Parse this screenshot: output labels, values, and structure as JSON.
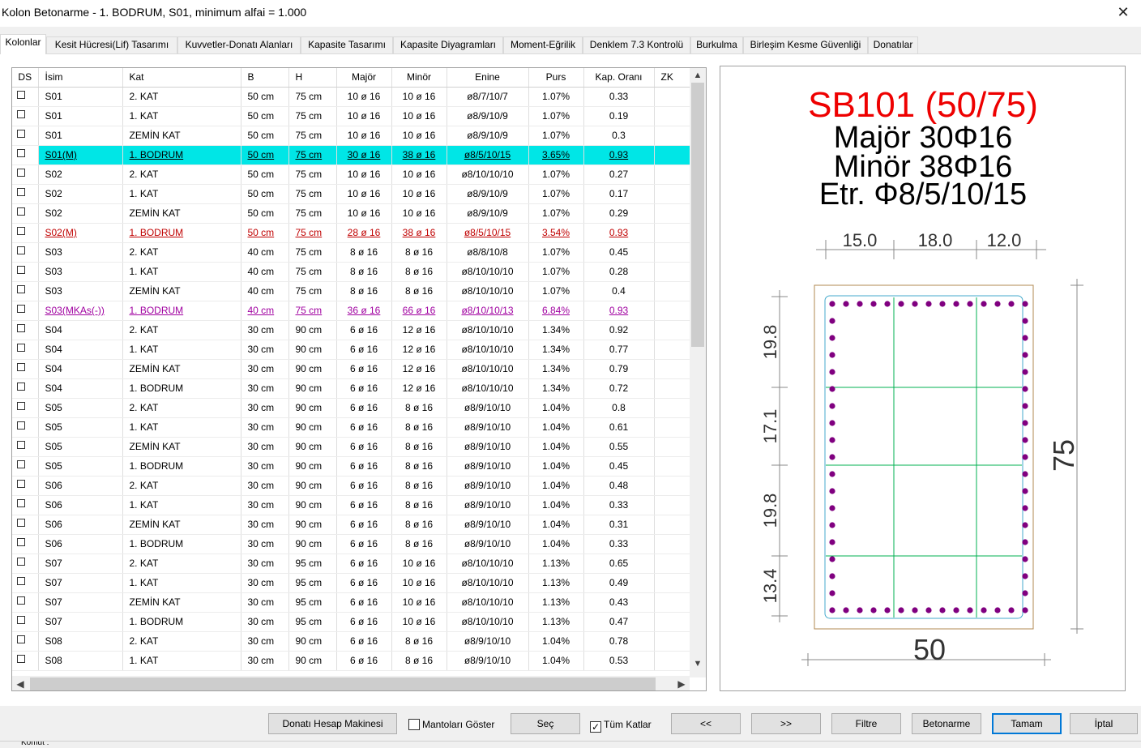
{
  "window": {
    "title": "Kolon Betonarme - 1. BODRUM, S01, minimum alfai = 1.000",
    "close_glyph": "✕"
  },
  "tabs": [
    {
      "label": "Kolonlar",
      "active": true
    },
    {
      "label": "Kesit Hücresi(Lif) Tasarımı"
    },
    {
      "label": "Kuvvetler-Donatı Alanları"
    },
    {
      "label": "Kapasite Tasarımı"
    },
    {
      "label": "Kapasite Diyagramları"
    },
    {
      "label": "Moment-Eğrilik"
    },
    {
      "label": "Denklem 7.3 Kontrolü"
    },
    {
      "label": "Burkulma"
    },
    {
      "label": "Birleşim Kesme Güvenliği"
    },
    {
      "label": "Donatılar"
    }
  ],
  "table": {
    "headers": [
      "DS",
      "İsim",
      "Kat",
      "B",
      "H",
      "Majör",
      "Minör",
      "Enine",
      "Purs",
      "Kap. Oranı",
      "ZK"
    ],
    "rows": [
      {
        "isim": "S01",
        "kat": "2. KAT",
        "b": "50 cm",
        "h": "75 cm",
        "major": "10 ø 16",
        "minor": "10 ø 16",
        "enine": "ø8/7/10/7",
        "purs": "1.07%",
        "kap": "0.33",
        "style": ""
      },
      {
        "isim": "S01",
        "kat": "1. KAT",
        "b": "50 cm",
        "h": "75 cm",
        "major": "10 ø 16",
        "minor": "10 ø 16",
        "enine": "ø8/9/10/9",
        "purs": "1.07%",
        "kap": "0.19",
        "style": ""
      },
      {
        "isim": "S01",
        "kat": "ZEMİN KAT",
        "b": "50 cm",
        "h": "75 cm",
        "major": "10 ø 16",
        "minor": "10 ø 16",
        "enine": "ø8/9/10/9",
        "purs": "1.07%",
        "kap": "0.3",
        "style": ""
      },
      {
        "isim": "S01(M)",
        "kat": "1. BODRUM",
        "b": "50 cm",
        "h": "75 cm",
        "major": "30 ø 16",
        "minor": "38 ø 16",
        "enine": "ø8/5/10/15",
        "purs": "3.65%",
        "kap": "0.93",
        "style": "selected"
      },
      {
        "isim": "S02",
        "kat": "2. KAT",
        "b": "50 cm",
        "h": "75 cm",
        "major": "10 ø 16",
        "minor": "10 ø 16",
        "enine": "ø8/10/10/10",
        "purs": "1.07%",
        "kap": "0.27",
        "style": ""
      },
      {
        "isim": "S02",
        "kat": "1. KAT",
        "b": "50 cm",
        "h": "75 cm",
        "major": "10 ø 16",
        "minor": "10 ø 16",
        "enine": "ø8/9/10/9",
        "purs": "1.07%",
        "kap": "0.17",
        "style": ""
      },
      {
        "isim": "S02",
        "kat": "ZEMİN KAT",
        "b": "50 cm",
        "h": "75 cm",
        "major": "10 ø 16",
        "minor": "10 ø 16",
        "enine": "ø8/9/10/9",
        "purs": "1.07%",
        "kap": "0.29",
        "style": ""
      },
      {
        "isim": "S02(M)",
        "kat": "1. BODRUM",
        "b": "50 cm",
        "h": "75 cm",
        "major": "28 ø 16",
        "minor": "38 ø 16",
        "enine": "ø8/5/10/15",
        "purs": "3.54%",
        "kap": "0.93",
        "style": "red"
      },
      {
        "isim": "S03",
        "kat": "2. KAT",
        "b": "40 cm",
        "h": "75 cm",
        "major": "8 ø 16",
        "minor": "8 ø 16",
        "enine": "ø8/8/10/8",
        "purs": "1.07%",
        "kap": "0.45",
        "style": ""
      },
      {
        "isim": "S03",
        "kat": "1. KAT",
        "b": "40 cm",
        "h": "75 cm",
        "major": "8 ø 16",
        "minor": "8 ø 16",
        "enine": "ø8/10/10/10",
        "purs": "1.07%",
        "kap": "0.28",
        "style": ""
      },
      {
        "isim": "S03",
        "kat": "ZEMİN KAT",
        "b": "40 cm",
        "h": "75 cm",
        "major": "8 ø 16",
        "minor": "8 ø 16",
        "enine": "ø8/10/10/10",
        "purs": "1.07%",
        "kap": "0.4",
        "style": ""
      },
      {
        "isim": "S03(MKAs(-))",
        "kat": "1. BODRUM",
        "b": "40 cm",
        "h": "75 cm",
        "major": "36 ø 16",
        "minor": "66 ø 16",
        "enine": "ø8/10/10/13",
        "purs": "6.84%",
        "kap": "0.93",
        "style": "purple"
      },
      {
        "isim": "S04",
        "kat": "2. KAT",
        "b": "30 cm",
        "h": "90 cm",
        "major": "6 ø 16",
        "minor": "12 ø 16",
        "enine": "ø8/10/10/10",
        "purs": "1.34%",
        "kap": "0.92",
        "style": ""
      },
      {
        "isim": "S04",
        "kat": "1. KAT",
        "b": "30 cm",
        "h": "90 cm",
        "major": "6 ø 16",
        "minor": "12 ø 16",
        "enine": "ø8/10/10/10",
        "purs": "1.34%",
        "kap": "0.77",
        "style": ""
      },
      {
        "isim": "S04",
        "kat": "ZEMİN KAT",
        "b": "30 cm",
        "h": "90 cm",
        "major": "6 ø 16",
        "minor": "12 ø 16",
        "enine": "ø8/10/10/10",
        "purs": "1.34%",
        "kap": "0.79",
        "style": ""
      },
      {
        "isim": "S04",
        "kat": "1. BODRUM",
        "b": "30 cm",
        "h": "90 cm",
        "major": "6 ø 16",
        "minor": "12 ø 16",
        "enine": "ø8/10/10/10",
        "purs": "1.34%",
        "kap": "0.72",
        "style": ""
      },
      {
        "isim": "S05",
        "kat": "2. KAT",
        "b": "30 cm",
        "h": "90 cm",
        "major": "6 ø 16",
        "minor": "8 ø 16",
        "enine": "ø8/9/10/10",
        "purs": "1.04%",
        "kap": "0.8",
        "style": ""
      },
      {
        "isim": "S05",
        "kat": "1. KAT",
        "b": "30 cm",
        "h": "90 cm",
        "major": "6 ø 16",
        "minor": "8 ø 16",
        "enine": "ø8/9/10/10",
        "purs": "1.04%",
        "kap": "0.61",
        "style": ""
      },
      {
        "isim": "S05",
        "kat": "ZEMİN KAT",
        "b": "30 cm",
        "h": "90 cm",
        "major": "6 ø 16",
        "minor": "8 ø 16",
        "enine": "ø8/9/10/10",
        "purs": "1.04%",
        "kap": "0.55",
        "style": ""
      },
      {
        "isim": "S05",
        "kat": "1. BODRUM",
        "b": "30 cm",
        "h": "90 cm",
        "major": "6 ø 16",
        "minor": "8 ø 16",
        "enine": "ø8/9/10/10",
        "purs": "1.04%",
        "kap": "0.45",
        "style": ""
      },
      {
        "isim": "S06",
        "kat": "2. KAT",
        "b": "30 cm",
        "h": "90 cm",
        "major": "6 ø 16",
        "minor": "8 ø 16",
        "enine": "ø8/9/10/10",
        "purs": "1.04%",
        "kap": "0.48",
        "style": ""
      },
      {
        "isim": "S06",
        "kat": "1. KAT",
        "b": "30 cm",
        "h": "90 cm",
        "major": "6 ø 16",
        "minor": "8 ø 16",
        "enine": "ø8/9/10/10",
        "purs": "1.04%",
        "kap": "0.33",
        "style": ""
      },
      {
        "isim": "S06",
        "kat": "ZEMİN KAT",
        "b": "30 cm",
        "h": "90 cm",
        "major": "6 ø 16",
        "minor": "8 ø 16",
        "enine": "ø8/9/10/10",
        "purs": "1.04%",
        "kap": "0.31",
        "style": ""
      },
      {
        "isim": "S06",
        "kat": "1. BODRUM",
        "b": "30 cm",
        "h": "90 cm",
        "major": "6 ø 16",
        "minor": "8 ø 16",
        "enine": "ø8/9/10/10",
        "purs": "1.04%",
        "kap": "0.33",
        "style": ""
      },
      {
        "isim": "S07",
        "kat": "2. KAT",
        "b": "30 cm",
        "h": "95 cm",
        "major": "6 ø 16",
        "minor": "10 ø 16",
        "enine": "ø8/10/10/10",
        "purs": "1.13%",
        "kap": "0.65",
        "style": ""
      },
      {
        "isim": "S07",
        "kat": "1. KAT",
        "b": "30 cm",
        "h": "95 cm",
        "major": "6 ø 16",
        "minor": "10 ø 16",
        "enine": "ø8/10/10/10",
        "purs": "1.13%",
        "kap": "0.49",
        "style": ""
      },
      {
        "isim": "S07",
        "kat": "ZEMİN KAT",
        "b": "30 cm",
        "h": "95 cm",
        "major": "6 ø 16",
        "minor": "10 ø 16",
        "enine": "ø8/10/10/10",
        "purs": "1.13%",
        "kap": "0.43",
        "style": ""
      },
      {
        "isim": "S07",
        "kat": "1. BODRUM",
        "b": "30 cm",
        "h": "95 cm",
        "major": "6 ø 16",
        "minor": "10 ø 16",
        "enine": "ø8/10/10/10",
        "purs": "1.13%",
        "kap": "0.47",
        "style": ""
      },
      {
        "isim": "S08",
        "kat": "2. KAT",
        "b": "30 cm",
        "h": "90 cm",
        "major": "6 ø 16",
        "minor": "8 ø 16",
        "enine": "ø8/9/10/10",
        "purs": "1.04%",
        "kap": "0.78",
        "style": ""
      },
      {
        "isim": "S08",
        "kat": "1. KAT",
        "b": "30 cm",
        "h": "90 cm",
        "major": "6 ø 16",
        "minor": "8 ø 16",
        "enine": "ø8/9/10/10",
        "purs": "1.04%",
        "kap": "0.53",
        "style": ""
      }
    ]
  },
  "drawing": {
    "title": "SB101 (50/75)",
    "major_text": "Majör 30Φ16",
    "minor_text": "Minör 38Φ16",
    "stirrup_text": "Etr. Φ8/5/10/15",
    "top_dims": [
      "15.0",
      "18.0",
      "12.0"
    ],
    "left_dims": [
      "19.8",
      "17.1",
      "19.8",
      "13.4"
    ],
    "width_label": "50",
    "height_label": "75",
    "title_color": "#ee0000",
    "bar_color": "#800080",
    "tie_color": "#00b050"
  },
  "buttons": {
    "calculator": "Donatı Hesap Makinesi",
    "show_jackets": "Mantoları Göster",
    "select": "Seç",
    "all_floors": "Tüm Katlar",
    "prev": "<<",
    "next": ">>",
    "filter": "Filtre",
    "concrete": "Betonarme",
    "ok": "Tamam",
    "cancel": "İptal"
  },
  "status_text": "Komut :"
}
